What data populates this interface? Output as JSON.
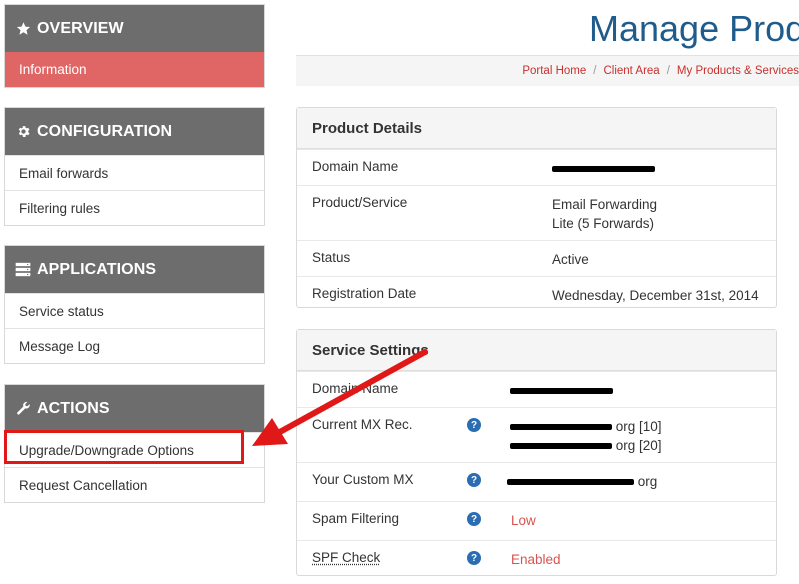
{
  "sidebar": {
    "overview": {
      "title": "OVERVIEW",
      "items": [
        "Information"
      ]
    },
    "configuration": {
      "title": "CONFIGURATION",
      "items": [
        "Email forwards",
        "Filtering rules"
      ]
    },
    "applications": {
      "title": "APPLICATIONS",
      "items": [
        "Service status",
        "Message Log"
      ]
    },
    "actions": {
      "title": "ACTIONS",
      "items": [
        "Upgrade/Downgrade Options",
        "Request Cancellation"
      ]
    }
  },
  "header": {
    "title": "Manage Prod",
    "breadcrumb": [
      "Portal Home",
      "Client Area",
      "My Products & Services"
    ],
    "breadcrumb_sep": "/"
  },
  "product_details": {
    "title": "Product Details",
    "rows": {
      "domain_label": "Domain Name",
      "product_label": "Product/Service",
      "product_value_1": "Email Forwarding",
      "product_value_2": "Lite (5 Forwards)",
      "status_label": "Status",
      "status_value": "Active",
      "regdate_label": "Registration Date",
      "regdate_value": "Wednesday, December 31st, 2014"
    }
  },
  "service_settings": {
    "title": "Service Settings",
    "rows": {
      "domain_label": "Domain Name",
      "mx_label": "Current MX Rec.",
      "mx_suffix_1": "org [10]",
      "mx_suffix_2": "org [20]",
      "custom_mx_label": "Your Custom MX",
      "custom_mx_suffix": "org",
      "spam_label": "Spam Filtering",
      "spam_value": "Low",
      "spf_label": "SPF Check",
      "spf_value": "Enabled"
    },
    "help_glyph": "?"
  },
  "colors": {
    "sidebar_head": "#6d6d6d",
    "active_item": "#e06666",
    "title_blue": "#1f5c8b",
    "link_red": "#c9302c",
    "annotation_red": "#e01818"
  }
}
